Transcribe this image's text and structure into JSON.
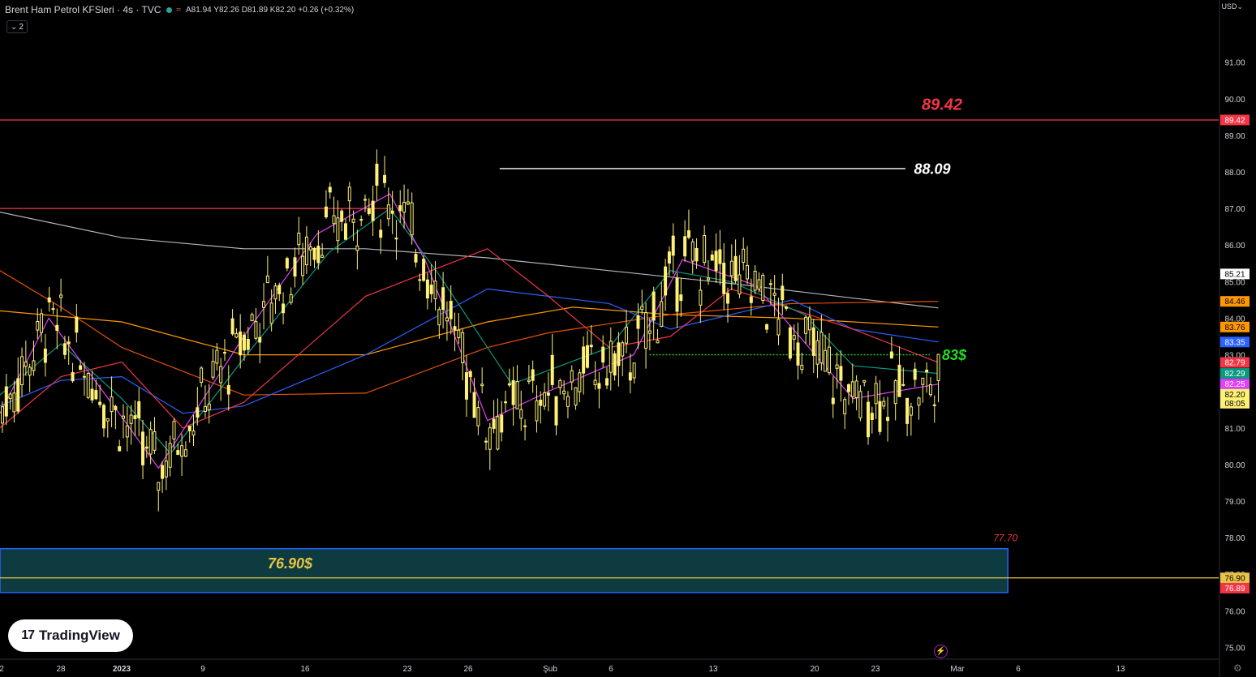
{
  "header": {
    "title": "Brent Ham Petrol KFSleri · 4s · TVC",
    "ohlc": "A81.94 Y82.26 D81.89 K82.20 +0.26 (+0.32%)",
    "collapse_label": "2"
  },
  "currency": "USD",
  "logo_text": "TradingView",
  "icons": {
    "bolt": "lightning-icon",
    "settings": "gear-icon",
    "logo": "tradingview-logo-icon"
  },
  "colors": {
    "background": "#000000",
    "candle": "#fff176",
    "resistance": "#f23645",
    "support_zone": "#0d3b3f",
    "support_border": "#2962ff",
    "support_line": "#e8c547",
    "level_83": "#22dd22",
    "ma200_white": "#b2b5be"
  },
  "chart_data": {
    "type": "candlestick",
    "y_range": [
      74.7,
      92.7
    ],
    "y_ticks": [
      "91.00",
      "90.00",
      "89.00",
      "88.00",
      "87.00",
      "86.00",
      "85.00",
      "84.00",
      "83.00",
      "81.00",
      "80.00",
      "79.00",
      "78.00",
      "77.00",
      "76.00",
      "75.00"
    ],
    "x_ticks": [
      "2",
      "28",
      "2023",
      "9",
      "16",
      "23",
      "26",
      "Şub",
      "6",
      "13",
      "20",
      "23",
      "Mar",
      "6",
      "13"
    ],
    "annotations": [
      {
        "text": "89.42",
        "color": "#f23645",
        "value": 89.42
      },
      {
        "text": "88.09",
        "color": "#ffffff",
        "value": 88.09
      },
      {
        "text": "83$",
        "color": "#22dd22",
        "value": 83.0
      },
      {
        "text": "76.90$",
        "color": "#e8c547",
        "value": 76.9
      },
      {
        "text": "77.70",
        "color": "#f23645",
        "value": 77.7
      }
    ],
    "price_labels": [
      {
        "text": "89.42",
        "bg": "#f23645",
        "fg": "#ffffff",
        "value": 89.42
      },
      {
        "text": "85.21",
        "bg": "#ffffff",
        "fg": "#000000",
        "value": 85.21
      },
      {
        "text": "84.46",
        "bg": "#ff9800",
        "fg": "#000000",
        "value": 84.46
      },
      {
        "text": "83.76",
        "bg": "#ff9800",
        "fg": "#000000",
        "value": 83.76
      },
      {
        "text": "83.35",
        "bg": "#2962ff",
        "fg": "#ffffff",
        "value": 83.35
      },
      {
        "text": "82.79",
        "bg": "#f23645",
        "fg": "#ffffff",
        "value": 82.79
      },
      {
        "text": "82.29",
        "bg": "#089981",
        "fg": "#ffffff",
        "value": 82.49
      },
      {
        "text": "82.25",
        "bg": "#e040fb",
        "fg": "#ffffff",
        "value": 82.2
      },
      {
        "text": "82.20",
        "bg": "#fff176",
        "fg": "#000000",
        "value": 81.92,
        "sub": "08:05"
      },
      {
        "text": "76.90",
        "bg": "#e8c547",
        "fg": "#000000",
        "value": 76.9
      },
      {
        "text": "76.89",
        "bg": "#f23645",
        "fg": "#ffffff",
        "value": 76.62
      }
    ],
    "levels": [
      {
        "name": "resistance-89",
        "value": 89.42,
        "color": "#f23645"
      },
      {
        "name": "resistance-87",
        "value": 87.0,
        "color": "#f23645",
        "x_end_frac": 0.32
      },
      {
        "name": "high-88",
        "value": 88.09,
        "color": "#ffffff"
      },
      {
        "name": "level-83",
        "value": 83.0,
        "color": "#22dd22",
        "dotted": true
      },
      {
        "name": "support-76.9",
        "value": 76.9,
        "color": "#e8c547"
      }
    ],
    "support_zone": [
      76.5,
      77.7
    ],
    "series": [
      {
        "name": "",
        "color": "#b2b5be",
        "values": [
          [
            0,
            86.9
          ],
          [
            0.1,
            86.2
          ],
          [
            0.2,
            85.9
          ],
          [
            0.3,
            85.9
          ],
          [
            0.4,
            85.65
          ],
          [
            0.5,
            85.3
          ],
          [
            0.6,
            84.95
          ],
          [
            0.7,
            84.55
          ],
          [
            0.77,
            84.28
          ]
        ]
      },
      {
        "name": "",
        "color": "#ff9800",
        "values": [
          [
            0,
            84.2
          ],
          [
            0.1,
            83.9
          ],
          [
            0.2,
            83.0
          ],
          [
            0.3,
            83.0
          ],
          [
            0.4,
            83.9
          ],
          [
            0.47,
            84.3
          ],
          [
            0.55,
            84.1
          ],
          [
            0.65,
            84.0
          ],
          [
            0.77,
            83.76
          ]
        ]
      },
      {
        "name": "",
        "color": "#e65100",
        "values": [
          [
            0,
            85.3
          ],
          [
            0.05,
            84.3
          ],
          [
            0.1,
            83.2
          ],
          [
            0.2,
            81.9
          ],
          [
            0.3,
            81.95
          ],
          [
            0.4,
            83.2
          ],
          [
            0.45,
            83.6
          ],
          [
            0.55,
            84.1
          ],
          [
            0.65,
            84.4
          ],
          [
            0.77,
            84.46
          ]
        ]
      },
      {
        "name": "",
        "color": "#2962ff",
        "values": [
          [
            0,
            81.6
          ],
          [
            0.05,
            82.3
          ],
          [
            0.1,
            82.4
          ],
          [
            0.15,
            81.4
          ],
          [
            0.2,
            81.6
          ],
          [
            0.3,
            83.0
          ],
          [
            0.4,
            84.8
          ],
          [
            0.5,
            84.4
          ],
          [
            0.55,
            83.7
          ],
          [
            0.65,
            84.5
          ],
          [
            0.7,
            83.7
          ],
          [
            0.77,
            83.35
          ]
        ]
      },
      {
        "name": "",
        "color": "#f23645",
        "values": [
          [
            0,
            81.0
          ],
          [
            0.05,
            82.4
          ],
          [
            0.1,
            82.8
          ],
          [
            0.15,
            81.0
          ],
          [
            0.2,
            81.7
          ],
          [
            0.3,
            84.6
          ],
          [
            0.4,
            85.9
          ],
          [
            0.45,
            84.6
          ],
          [
            0.5,
            83.2
          ],
          [
            0.55,
            83.5
          ],
          [
            0.6,
            84.8
          ],
          [
            0.7,
            83.7
          ],
          [
            0.77,
            82.79
          ]
        ]
      },
      {
        "name": "",
        "color": "#089981",
        "values": [
          [
            0,
            81.9
          ],
          [
            0.05,
            83.3
          ],
          [
            0.1,
            81.8
          ],
          [
            0.14,
            80.3
          ],
          [
            0.2,
            82.9
          ],
          [
            0.27,
            85.8
          ],
          [
            0.32,
            87.0
          ],
          [
            0.36,
            85.2
          ],
          [
            0.42,
            82.2
          ],
          [
            0.5,
            83.2
          ],
          [
            0.55,
            85.3
          ],
          [
            0.6,
            85.0
          ],
          [
            0.66,
            84.1
          ],
          [
            0.7,
            82.7
          ],
          [
            0.77,
            82.49
          ]
        ]
      },
      {
        "name": "",
        "color": "#e040fb",
        "values": [
          [
            0,
            81.4
          ],
          [
            0.04,
            84.0
          ],
          [
            0.1,
            81.3
          ],
          [
            0.13,
            79.9
          ],
          [
            0.2,
            83.5
          ],
          [
            0.26,
            86.3
          ],
          [
            0.32,
            87.4
          ],
          [
            0.35,
            85.5
          ],
          [
            0.4,
            81.2
          ],
          [
            0.45,
            82.0
          ],
          [
            0.52,
            83.0
          ],
          [
            0.56,
            85.6
          ],
          [
            0.62,
            84.9
          ],
          [
            0.7,
            81.8
          ],
          [
            0.77,
            82.2
          ]
        ]
      }
    ]
  }
}
